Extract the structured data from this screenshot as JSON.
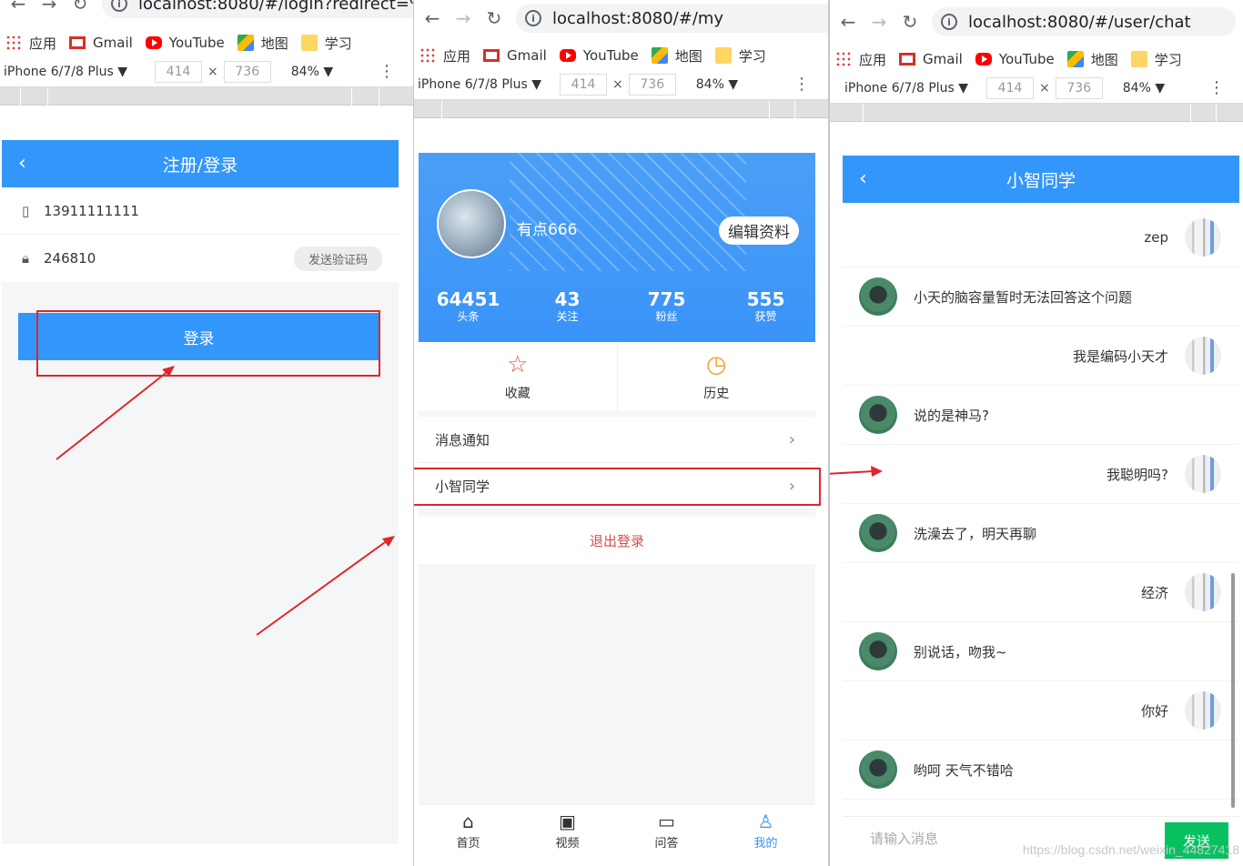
{
  "browser": {
    "bookmarks": [
      "应用",
      "Gmail",
      "YouTube",
      "地图",
      "学习"
    ],
    "device": "iPhone 6/7/8 Plus ▼",
    "width": "414",
    "height": "736",
    "zoom": "84% ▼"
  },
  "win1": {
    "url": "localhost:8080/#/login?redirect=%",
    "title": "注册/登录",
    "phone": "13911111111",
    "code": "246810",
    "send_code": "发送验证码",
    "login": "登录"
  },
  "win2": {
    "url": "localhost:8080/#/my",
    "username": "有点666",
    "edit": "编辑资料",
    "stats": [
      {
        "n": "64451",
        "l": "头条"
      },
      {
        "n": "43",
        "l": "关注"
      },
      {
        "n": "775",
        "l": "粉丝"
      },
      {
        "n": "555",
        "l": "获赞"
      }
    ],
    "favorites": "收藏",
    "history": "历史",
    "notifications": "消息通知",
    "xiaozhi": "小智同学",
    "logout": "退出登录",
    "tabs": [
      "首页",
      "视频",
      "问答",
      "我的"
    ]
  },
  "win3": {
    "url": "localhost:8080/#/user/chat",
    "title": "小智同学",
    "messages": [
      {
        "side": "right",
        "text": "zep"
      },
      {
        "side": "left",
        "text": "小天的脑容量暂时无法回答这个问题"
      },
      {
        "side": "right",
        "text": "我是编码小天才"
      },
      {
        "side": "left",
        "text": "说的是神马?"
      },
      {
        "side": "right",
        "text": "我聪明吗?"
      },
      {
        "side": "left",
        "text": "洗澡去了，明天再聊"
      },
      {
        "side": "right",
        "text": "经济"
      },
      {
        "side": "left",
        "text": "别说话，吻我~"
      },
      {
        "side": "right",
        "text": "你好"
      },
      {
        "side": "left",
        "text": "哟呵 天气不错哈"
      }
    ],
    "input_placeholder": "请输入消息",
    "send": "发送"
  },
  "watermark": "https://blog.csdn.net/weixin_44827418",
  "colors": {
    "primary": "#3296fa",
    "annotation": "#e0262a",
    "send": "#07c160",
    "logout": "#d84b4b"
  }
}
